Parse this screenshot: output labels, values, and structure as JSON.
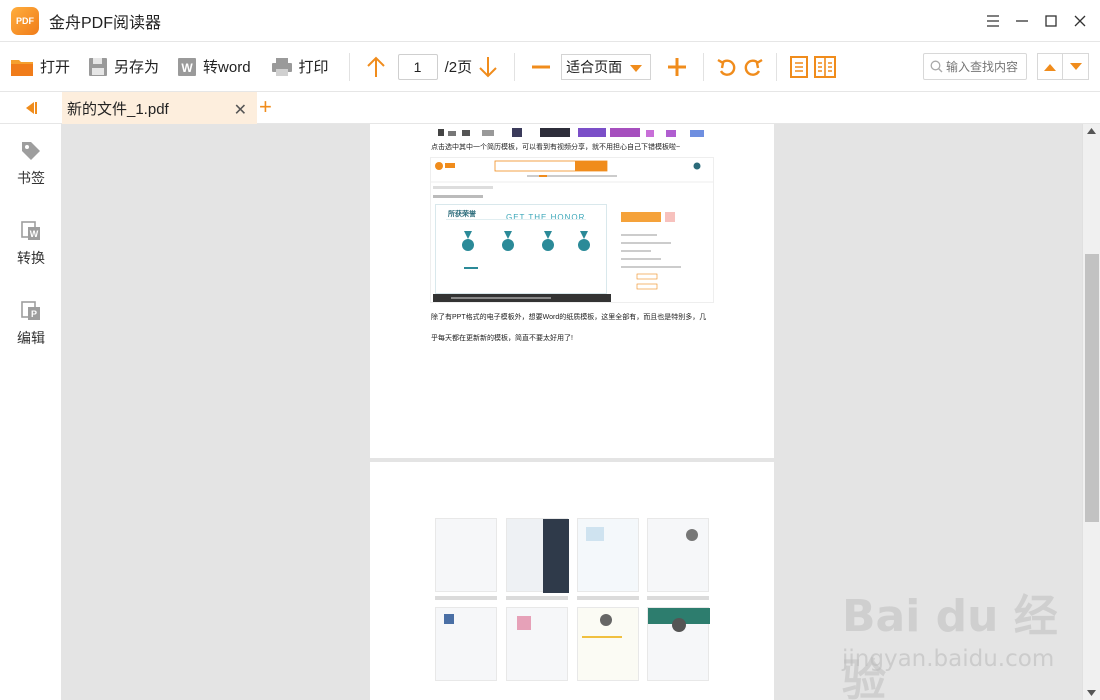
{
  "window": {
    "app_logo_text": "PDF",
    "title": "金舟PDF阅读器"
  },
  "toolbar": {
    "open_label": "打开",
    "save_as_label": "另存为",
    "to_word_label": "转word",
    "print_label": "打印",
    "current_page": "1",
    "total_pages": "/2页",
    "zoom_mode": "适合页面",
    "search_placeholder": "输入查找内容"
  },
  "tabs": {
    "active_name": "新的文件_1.pdf",
    "close_glyph": "✕",
    "add_glyph": "+"
  },
  "sidebar": {
    "items": [
      {
        "label": "书签",
        "icon": "tag-icon"
      },
      {
        "label": "转换",
        "icon": "convert-word-icon"
      },
      {
        "label": "编辑",
        "icon": "edit-p-icon"
      }
    ]
  },
  "document": {
    "page1": {
      "line_top": "点击选中其中一个简历模板，可以看到有视频分享，就不用担心自己下错模板啦~",
      "honor_heading": "所获荣誉",
      "honor_banner": "GET THE HONOR",
      "line_mid_1": "除了有PPT格式的电子模板外，想要Word的纸质模板，这里全部有，而且也是特别多，几",
      "line_mid_2": "乎每天都在更新新的模板，简直不要太好用了!"
    }
  },
  "watermark": {
    "brand": "Bai du 经验",
    "url": "jingyan.baidu.com"
  },
  "colors": {
    "accent": "#f08c1c",
    "tab_active_bg": "#fdeedd",
    "viewer_bg": "#e4e4e4"
  }
}
